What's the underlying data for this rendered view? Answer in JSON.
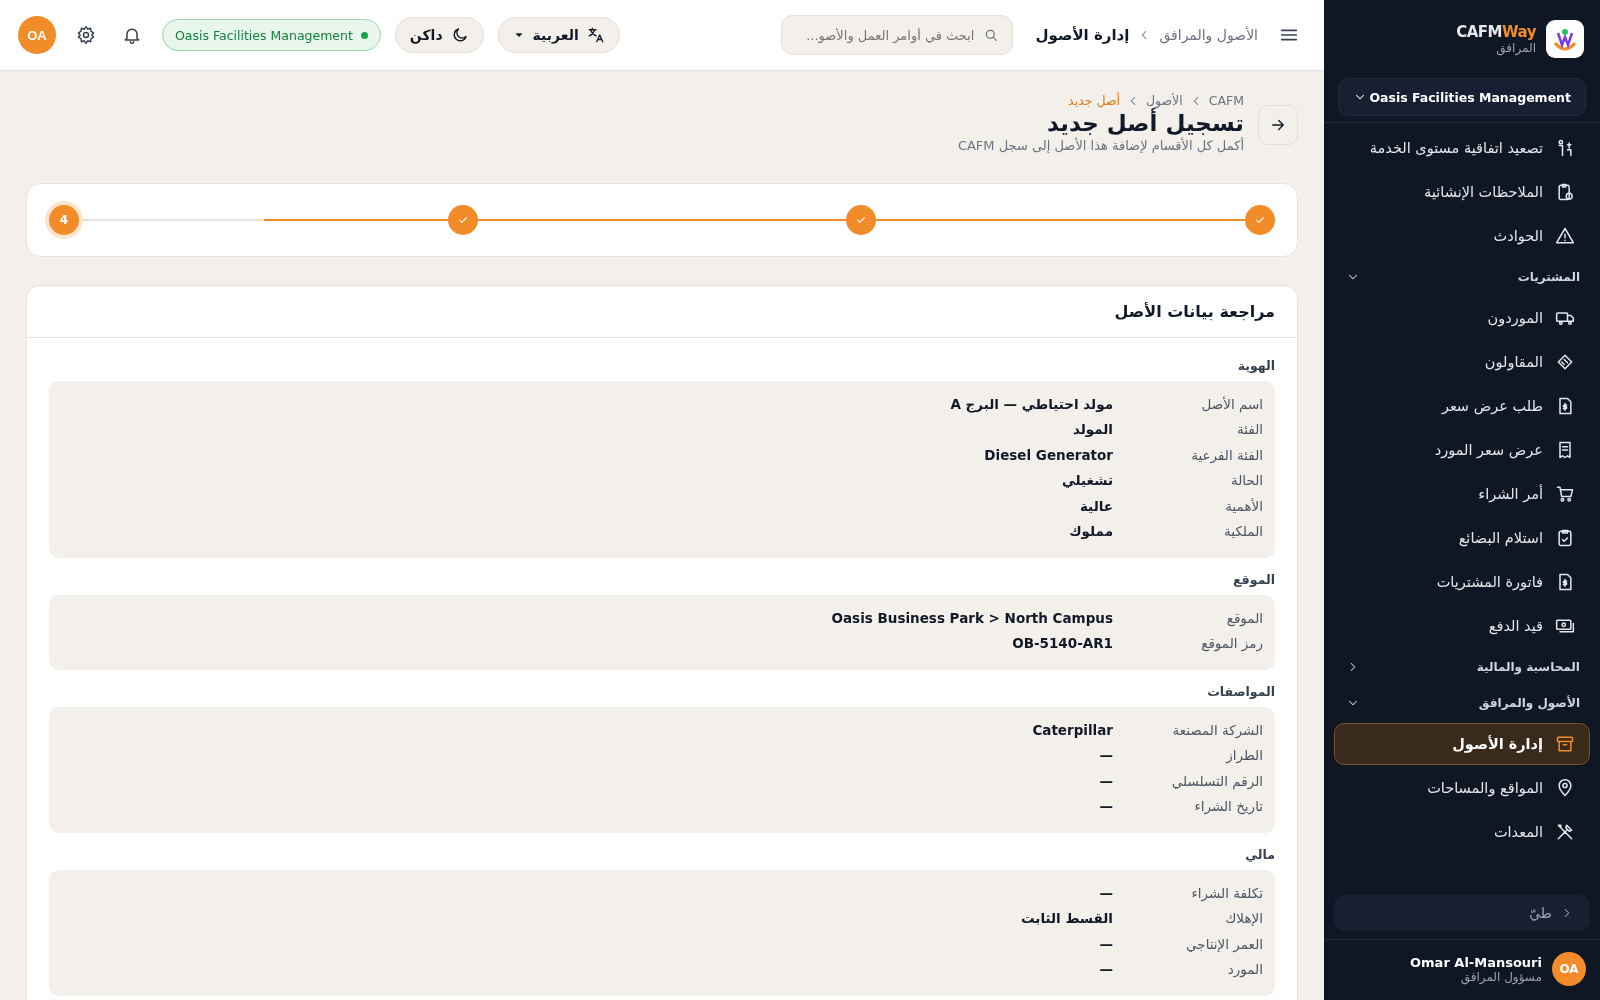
{
  "sidebar": {
    "brand": {
      "name": "CAFM",
      "accent": "Way",
      "subtitle": "المرافق"
    },
    "org_selector": "Oasis Facilities Management",
    "nav": [
      {
        "kind": "item",
        "label": "تصعيد اتفاقية مستوى الخدمة",
        "selected": false
      },
      {
        "kind": "item",
        "label": "الملاحظات الإنشائية",
        "selected": false
      },
      {
        "kind": "item",
        "label": "الحوادث",
        "selected": false
      },
      {
        "kind": "group",
        "label": "المشتريات",
        "expanded": true
      },
      {
        "kind": "item",
        "label": "الموردون",
        "selected": false
      },
      {
        "kind": "item",
        "label": "المقاولون",
        "selected": false
      },
      {
        "kind": "item",
        "label": "طلب عرض سعر",
        "selected": false
      },
      {
        "kind": "item",
        "label": "عرض سعر المورد",
        "selected": false
      },
      {
        "kind": "item",
        "label": "أمر الشراء",
        "selected": false
      },
      {
        "kind": "item",
        "label": "استلام البضائع",
        "selected": false
      },
      {
        "kind": "item",
        "label": "فاتورة المشتريات",
        "selected": false
      },
      {
        "kind": "item",
        "label": "قيد الدفع",
        "selected": false
      },
      {
        "kind": "group",
        "label": "المحاسبة والمالية",
        "expanded": false
      },
      {
        "kind": "group",
        "label": "الأصول والمرافق",
        "expanded": true
      },
      {
        "kind": "item",
        "label": "إدارة الأصول",
        "selected": true
      },
      {
        "kind": "item",
        "label": "المواقع والمساحات",
        "selected": false
      },
      {
        "kind": "item",
        "label": "المعدات",
        "selected": false
      }
    ],
    "collapse": "طيّ",
    "user": {
      "initials": "OA",
      "name": "Omar Al-Mansouri",
      "role": "مسؤول المرافق"
    }
  },
  "topbar": {
    "breadcrumb": [
      "الأصول والمرافق",
      "إدارة الأصول"
    ],
    "search": {
      "placeholder": "ابحث في أوامر العمل والأصو..."
    },
    "language": "العربية",
    "theme": "داكن",
    "org_badge": "Oasis Facilities Management",
    "avatar": "OA"
  },
  "page": {
    "breadcrumb": [
      "CAFM",
      "الأصول",
      "أصل جديد"
    ],
    "title": "تسجيل أصل جديد",
    "subtitle": "أكمل كل الأقسام لإضافة هذا الأصل إلى سجل CAFM",
    "steps": [
      {
        "done": true
      },
      {
        "done": true
      },
      {
        "done": true
      },
      {
        "done": false,
        "label": "4"
      }
    ],
    "review": {
      "title": "مراجعة بيانات الأصل",
      "sections": [
        {
          "title": "الهوية",
          "rows": [
            {
              "label": "اسم الأصل",
              "value": "مولد احتياطي — البرج A"
            },
            {
              "label": "الفئة",
              "value": "المولد"
            },
            {
              "label": "الفئة الفرعية",
              "value": "Diesel Generator"
            },
            {
              "label": "الحالة",
              "value": "تشغيلي"
            },
            {
              "label": "الأهمية",
              "value": "عالية"
            },
            {
              "label": "الملكية",
              "value": "مملوك"
            }
          ]
        },
        {
          "title": "الموقع",
          "rows": [
            {
              "label": "الموقع",
              "value": "Oasis Business Park > North Campus"
            },
            {
              "label": "رمز الموقع",
              "value": "OB-5140-AR1"
            }
          ]
        },
        {
          "title": "المواصفات",
          "rows": [
            {
              "label": "الشركة المصنعة",
              "value": "Caterpillar"
            },
            {
              "label": "الطراز",
              "value": "—"
            },
            {
              "label": "الرقم التسلسلي",
              "value": "—"
            },
            {
              "label": "تاريخ الشراء",
              "value": "—"
            }
          ]
        },
        {
          "title": "مالي",
          "rows": [
            {
              "label": "تكلفة الشراء",
              "value": "—"
            },
            {
              "label": "الإهلاك",
              "value": "القسط الثابت"
            },
            {
              "label": "العمر الإنتاجي",
              "value": "—"
            },
            {
              "label": "المورد",
              "value": "—"
            }
          ]
        }
      ]
    }
  }
}
